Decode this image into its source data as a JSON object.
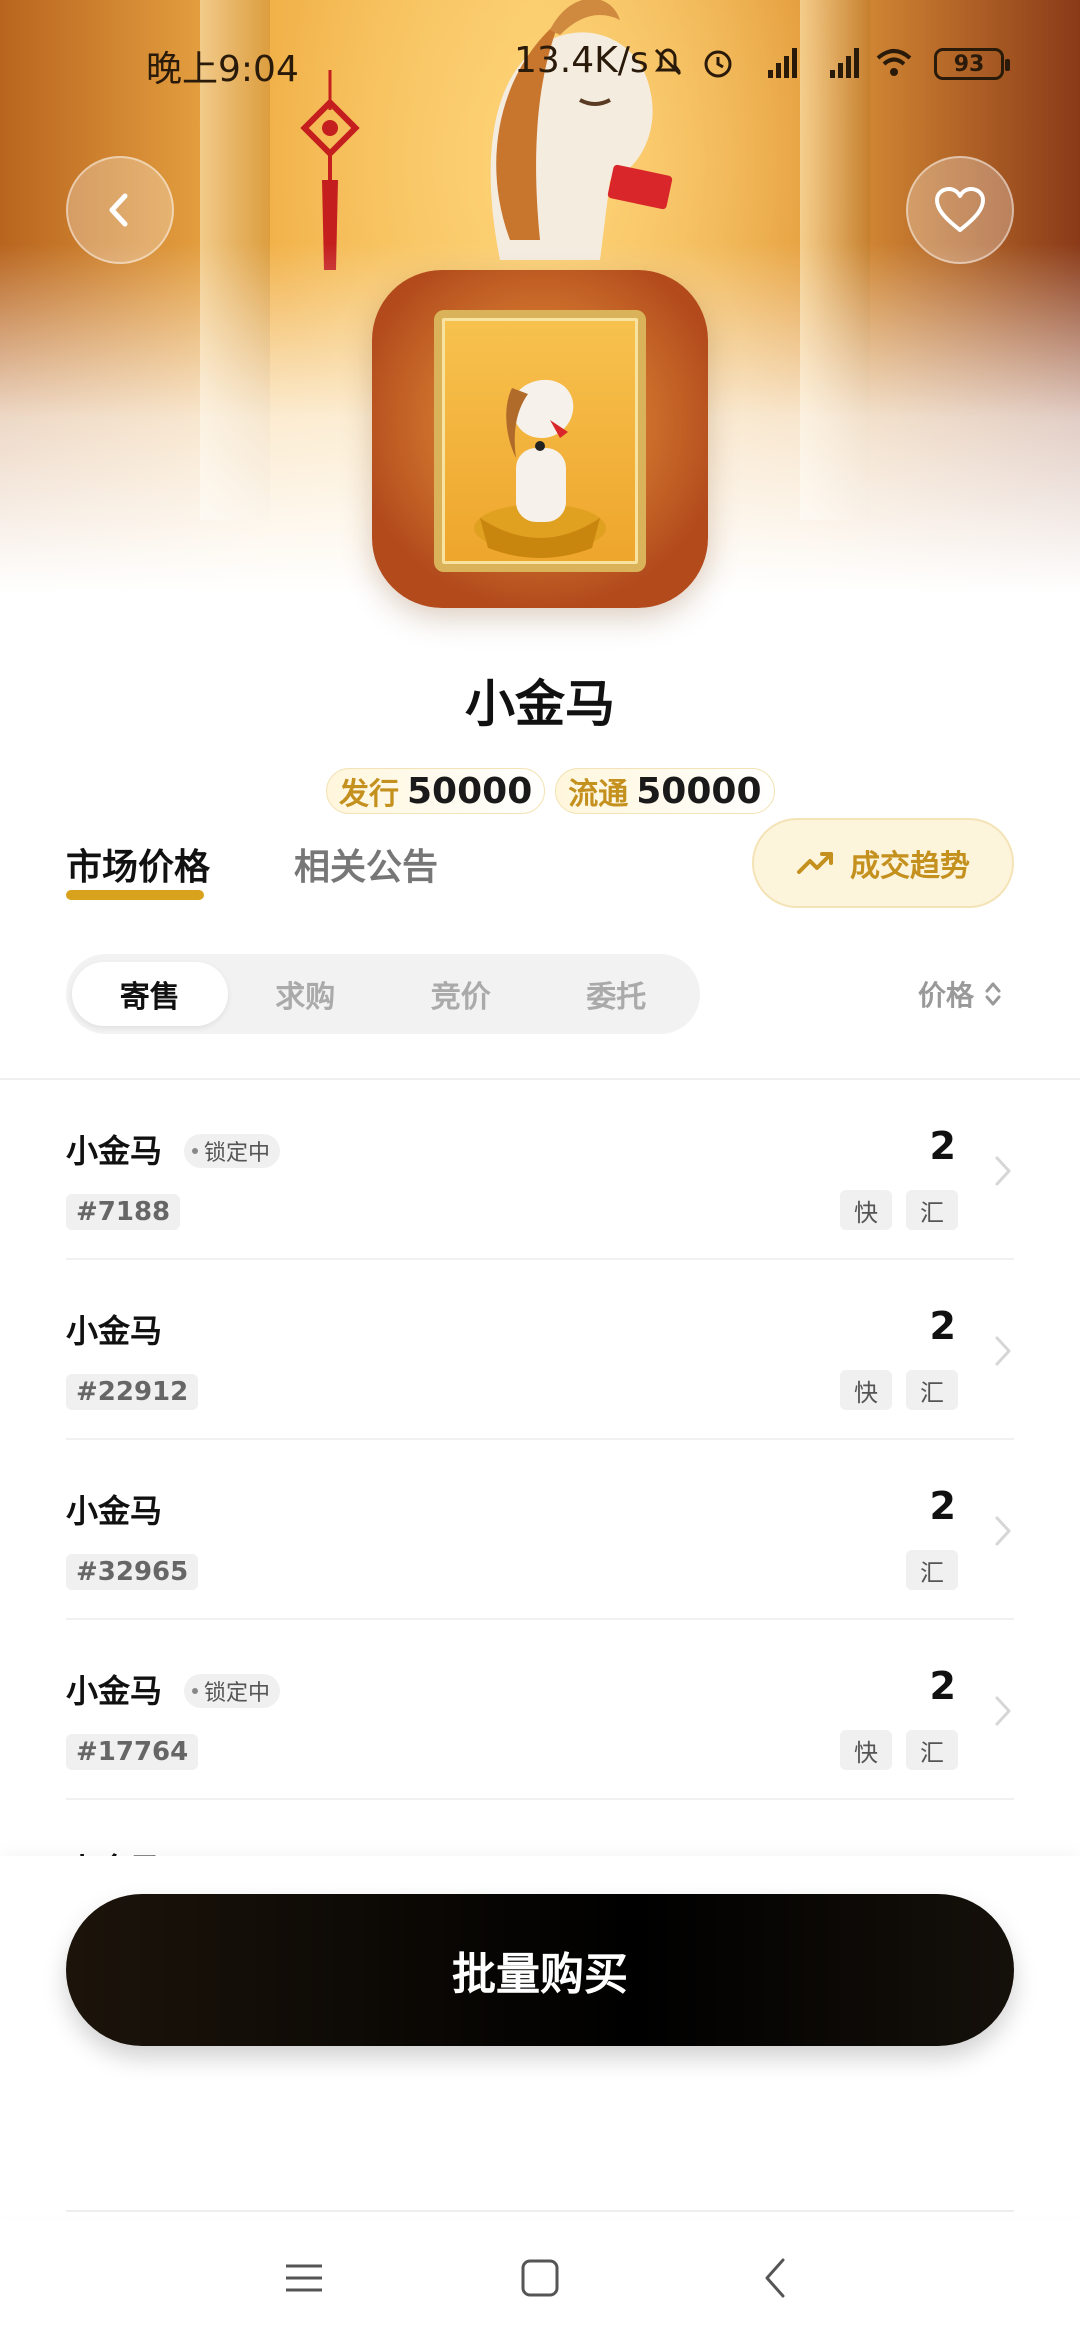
{
  "status_bar": {
    "time": "晚上9:04",
    "network_speed": "13.4K/s",
    "battery": "93"
  },
  "product": {
    "title": "小金马",
    "issued_label": "发行",
    "issued_value": "50000",
    "circulation_label": "流通",
    "circulation_value": "50000"
  },
  "tabs": {
    "market_price": "市场价格",
    "announcements": "相关公告",
    "trend_button": "成交趋势"
  },
  "segments": [
    "寄售",
    "求购",
    "竞价",
    "委托"
  ],
  "sort_label": "价格",
  "listings": [
    {
      "name": "小金马",
      "locked": true,
      "lock_label": "锁定中",
      "serial": "#7188",
      "price": "2",
      "tags": [
        "快",
        "汇"
      ]
    },
    {
      "name": "小金马",
      "locked": false,
      "lock_label": "",
      "serial": "#22912",
      "price": "2",
      "tags": [
        "快",
        "汇"
      ]
    },
    {
      "name": "小金马",
      "locked": false,
      "lock_label": "",
      "serial": "#32965",
      "price": "2",
      "tags": [
        "汇"
      ]
    },
    {
      "name": "小金马",
      "locked": true,
      "lock_label": "锁定中",
      "serial": "#17764",
      "price": "2",
      "tags": [
        "快",
        "汇"
      ]
    }
  ],
  "peek_row_name": "小金马",
  "buy_button": "批量购买",
  "colors": {
    "accent_gold": "#d9a21c",
    "gold_text": "#c4901e",
    "button_dark": "#000000"
  },
  "icons": {
    "back": "chevron-left-icon",
    "favorite": "heart-icon",
    "trend": "trending-up-icon",
    "sort": "sort-icon",
    "row_chevron": "chevron-right-icon"
  }
}
